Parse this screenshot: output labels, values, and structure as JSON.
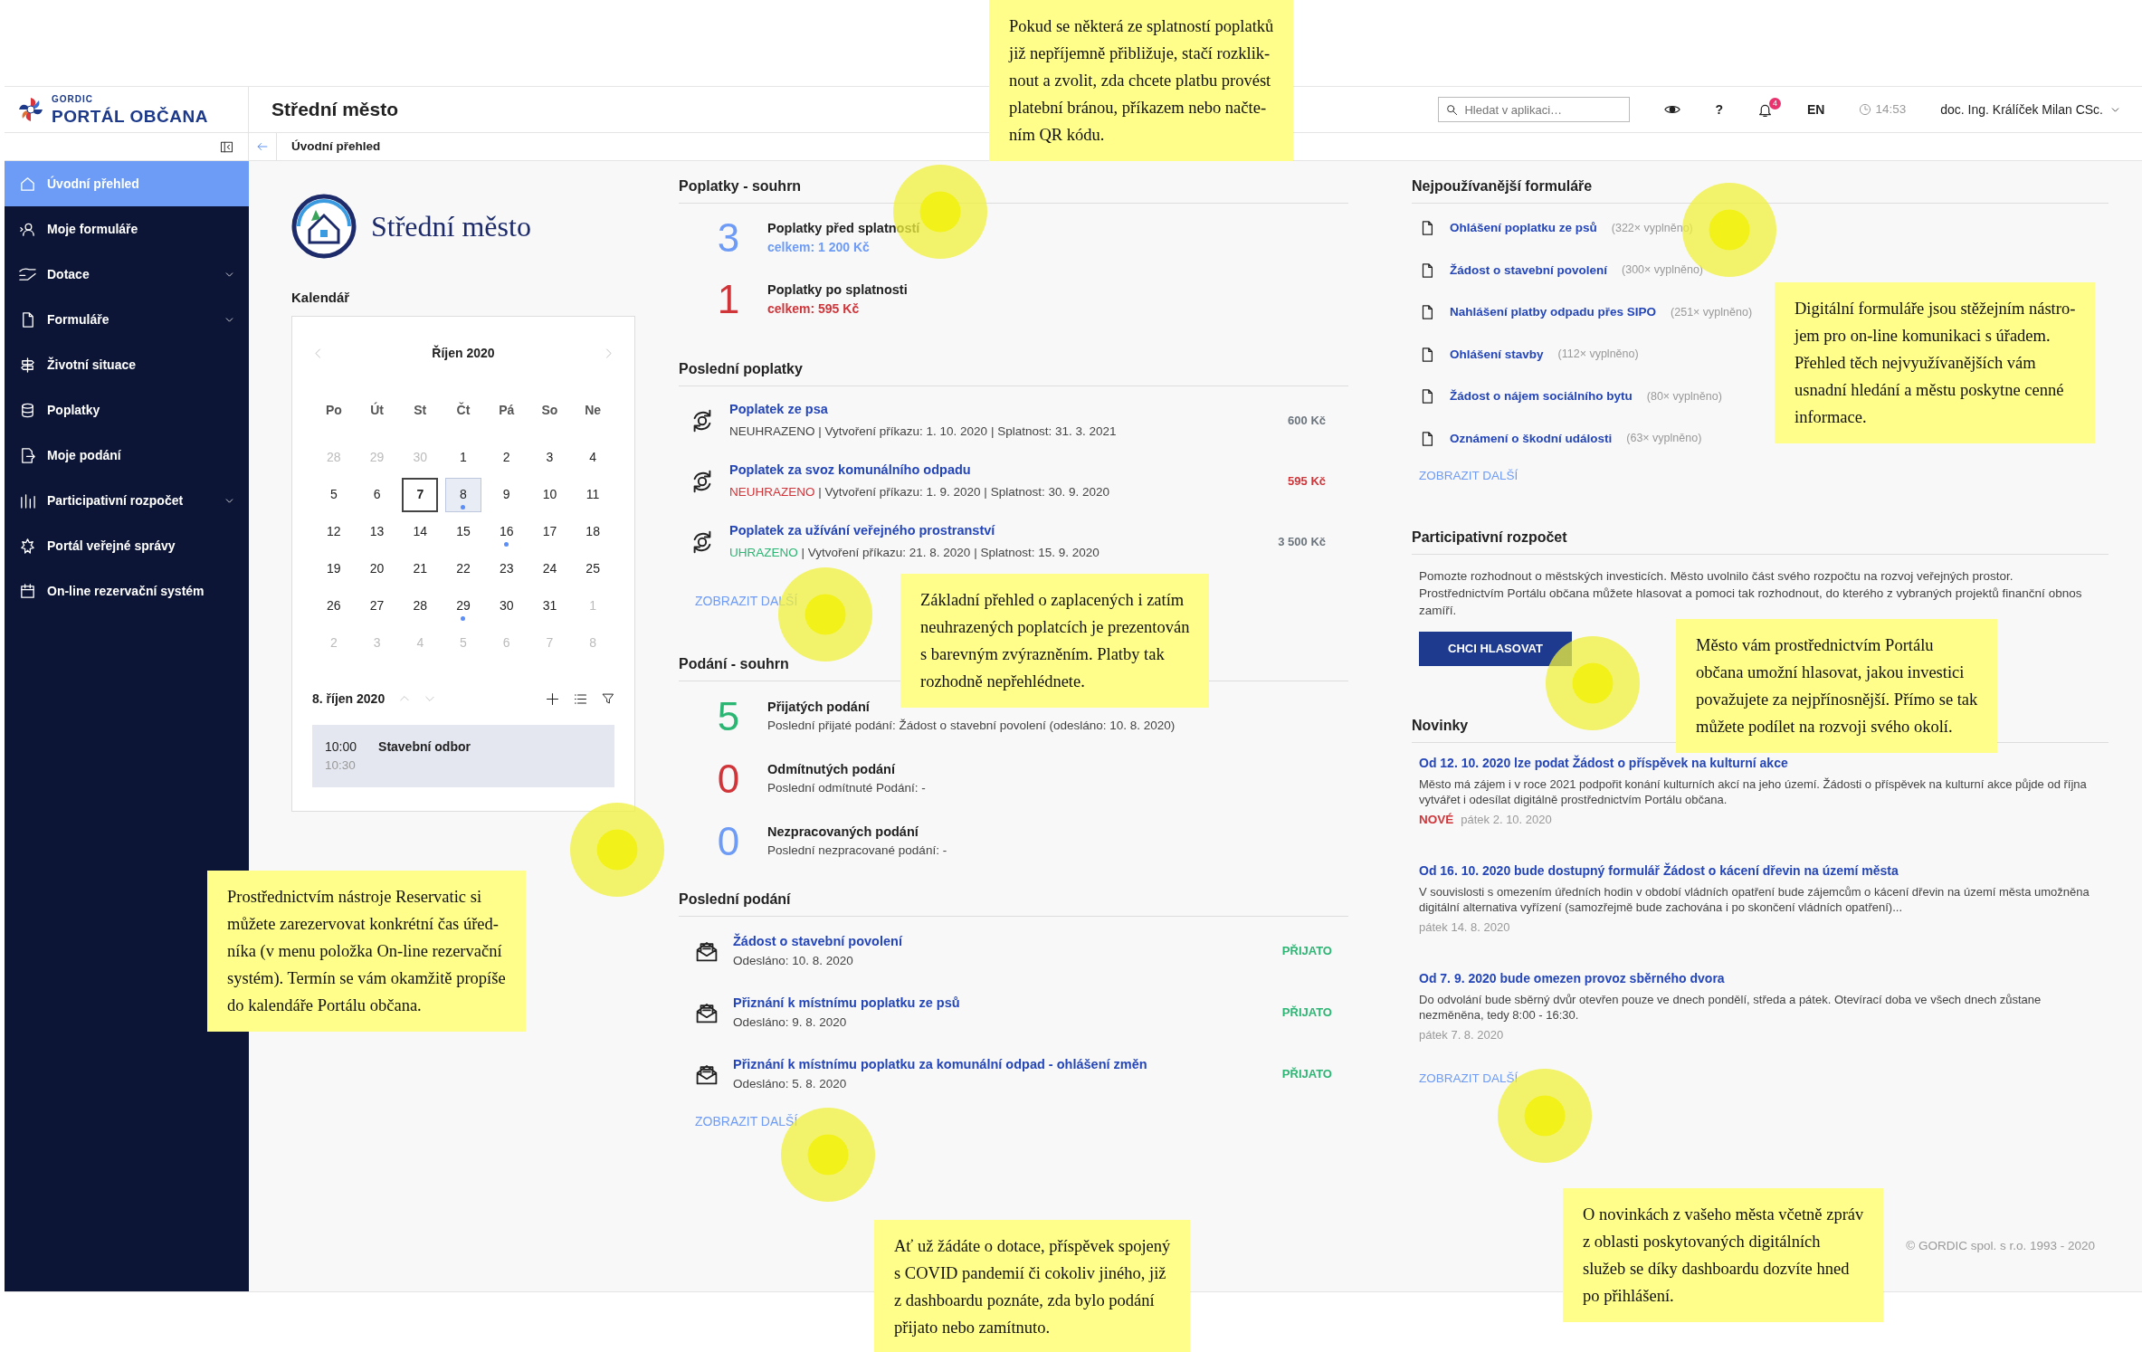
{
  "header": {
    "logo_small": "GORDIC",
    "logo_name": "PORTÁL OBČANA",
    "title": "Střední město",
    "search": {
      "placeholder": "Hledat v aplikaci…"
    },
    "help": "?",
    "notifications": "4",
    "language": "EN",
    "time": "14:53",
    "user": "doc. Ing. Králíček Milan CSc."
  },
  "breadcrumb": "Úvodní přehled",
  "sidebar": {
    "items": [
      {
        "label": "Úvodní přehled",
        "selected": true,
        "expandable": false
      },
      {
        "label": "Moje formuláře",
        "selected": false,
        "expandable": false
      },
      {
        "label": "Dotace",
        "selected": false,
        "expandable": true
      },
      {
        "label": "Formuláře",
        "selected": false,
        "expandable": true
      },
      {
        "label": "Životní situace",
        "selected": false,
        "expandable": false
      },
      {
        "label": "Poplatky",
        "selected": false,
        "expandable": false
      },
      {
        "label": "Moje podání",
        "selected": false,
        "expandable": false
      },
      {
        "label": "Participativní rozpočet",
        "selected": false,
        "expandable": true
      },
      {
        "label": "Portál veřejné správy",
        "selected": false,
        "expandable": false
      },
      {
        "label": "On-line rezervační systém",
        "selected": false,
        "expandable": false
      }
    ]
  },
  "city": {
    "name": "Střední město"
  },
  "calendar": {
    "title": "Kalendář",
    "month": "Říjen 2020",
    "weekdays": [
      "Po",
      "Út",
      "St",
      "Čt",
      "Pá",
      "So",
      "Ne"
    ],
    "weeks": [
      [
        {
          "d": "28",
          "other_month": true
        },
        {
          "d": "29",
          "other_month": true
        },
        {
          "d": "30",
          "other_month": true
        },
        {
          "d": "1"
        },
        {
          "d": "2"
        },
        {
          "d": "3"
        },
        {
          "d": "4"
        }
      ],
      [
        {
          "d": "5"
        },
        {
          "d": "6"
        },
        {
          "d": "7",
          "today": true
        },
        {
          "d": "8",
          "selected": true,
          "event": true
        },
        {
          "d": "9"
        },
        {
          "d": "10"
        },
        {
          "d": "11"
        }
      ],
      [
        {
          "d": "12"
        },
        {
          "d": "13"
        },
        {
          "d": "14"
        },
        {
          "d": "15"
        },
        {
          "d": "16",
          "event": true
        },
        {
          "d": "17"
        },
        {
          "d": "18"
        }
      ],
      [
        {
          "d": "19"
        },
        {
          "d": "20"
        },
        {
          "d": "21"
        },
        {
          "d": "22"
        },
        {
          "d": "23"
        },
        {
          "d": "24"
        },
        {
          "d": "25"
        }
      ],
      [
        {
          "d": "26"
        },
        {
          "d": "27"
        },
        {
          "d": "28"
        },
        {
          "d": "29",
          "event": true
        },
        {
          "d": "30"
        },
        {
          "d": "31"
        },
        {
          "d": "1",
          "other_month": true
        }
      ],
      [
        {
          "d": "2",
          "other_month": true
        },
        {
          "d": "3",
          "other_month": true
        },
        {
          "d": "4",
          "other_month": true
        },
        {
          "d": "5",
          "other_month": true
        },
        {
          "d": "6",
          "other_month": true
        },
        {
          "d": "7",
          "other_month": true
        },
        {
          "d": "8",
          "other_month": true
        }
      ]
    ],
    "day_label": "8. říjen 2020",
    "events": [
      {
        "start": "10:00",
        "end": "10:30",
        "name": "Stavební odbor"
      }
    ]
  },
  "fees_summary": {
    "title": "Poplatky - souhrn",
    "items": [
      {
        "count": "3",
        "kind": "info",
        "label": "Poplatky před splatností",
        "total": "celkem: 1 200 Kč"
      },
      {
        "count": "1",
        "kind": "danger",
        "label": "Poplatky po splatnosti",
        "total": "celkem: 595 Kč"
      }
    ]
  },
  "recent_fees": {
    "title": "Poslední poplatky",
    "items": [
      {
        "name": "Poplatek ze psa",
        "status": "NEUHRAZENO",
        "paid": false,
        "overdue": false,
        "details": "| Vytvoření příkazu: 1. 10. 2020 | Splatnost: 31. 3. 2021",
        "amount": "600 Kč"
      },
      {
        "name": "Poplatek za svoz komunálního odpadu",
        "status": "NEUHRAZENO",
        "paid": false,
        "overdue": true,
        "details": "| Vytvoření příkazu: 1. 9. 2020 | Splatnost: 30. 9. 2020",
        "amount": "595 Kč"
      },
      {
        "name": "Poplatek za užívání veřejného prostranství",
        "status": "UHRAZENO",
        "paid": true,
        "overdue": false,
        "details": "| Vytvoření příkazu: 21. 8. 2020 | Splatnost: 15. 9. 2020",
        "amount": "3 500 Kč"
      }
    ],
    "more": "ZOBRAZIT DALŠÍ"
  },
  "submissions_summary": {
    "title": "Podání - souhrn",
    "items": [
      {
        "count": "5",
        "kind": "success",
        "label": "Přijatých podání",
        "detail": "Poslední přijaté podání: Žádost o stavební povolení (odesláno: 10. 8. 2020)"
      },
      {
        "count": "0",
        "kind": "danger",
        "label": "Odmítnutých podání",
        "detail": "Poslední odmítnuté Podání: -"
      },
      {
        "count": "0",
        "kind": "info",
        "label": "Nezpracovaných podání",
        "detail": "Poslední nezpracované podání: -"
      }
    ]
  },
  "recent_submissions": {
    "title": "Poslední podání",
    "items": [
      {
        "name": "Žádost o stavební povolení",
        "sent": "Odesláno: 10. 8. 2020",
        "status": "PŘIJATO",
        "accepted": true
      },
      {
        "name": "Přiznání k místnímu poplatku ze psů",
        "sent": "Odesláno: 9. 8. 2020",
        "status": "PŘIJATO",
        "accepted": true
      },
      {
        "name": "Přiznání k místnímu poplatku za komunální odpad - ohlášení změn",
        "sent": "Odesláno: 5. 8. 2020",
        "status": "PŘIJATO",
        "accepted": true
      }
    ],
    "more": "ZOBRAZIT DALŠÍ"
  },
  "popular_forms": {
    "title": "Nejpoužívanější formuláře",
    "items": [
      {
        "name": "Ohlášení poplatku ze psů",
        "count": "(322× vyplněno)"
      },
      {
        "name": "Žádost o stavební povolení",
        "count": "(300× vyplněno)"
      },
      {
        "name": "Nahlášení platby odpadu přes SIPO",
        "count": "(251× vyplněno)"
      },
      {
        "name": "Ohlášení stavby",
        "count": "(112× vyplněno)"
      },
      {
        "name": "Žádost o nájem sociálního bytu",
        "count": "(80× vyplněno)"
      },
      {
        "name": "Oznámení o škodní události",
        "count": "(63× vyplněno)"
      }
    ],
    "more": "ZOBRAZIT DALŠÍ"
  },
  "participatory_budget": {
    "title": "Participativní rozpočet",
    "text": "Pomozte rozhodnout o městských investicích. Město uvolnilo část svého rozpočtu na rozvoj veřejných prostor. Prostřednictvím Portálu občana můžete hlasovat a pomoci tak rozhodnout, do kterého z vybraných projektů finanční obnos zamíří.",
    "button": "CHCI HLASOVAT"
  },
  "news": {
    "title": "Novinky",
    "items": [
      {
        "title": "Od 12. 10. 2020 lze podat Žádost o příspěvek na kulturní akce",
        "text": "Město má zájem i v roce 2021 podpořit konání kulturních akcí na jeho území. Žádosti o příspěvek na kulturní akce půjde od října vytvářet i odesílat digitálně prostřednictvím Portálu občana.",
        "badge": "NOVÉ",
        "date": "pátek 2. 10. 2020"
      },
      {
        "title": "Od 16. 10. 2020 bude dostupný formulář Žádost o kácení dřevin na území města",
        "text": "V souvislosti s omezením úředních hodin v období vládních opatření bude zájemcům o kácení dřevin na území města umožněna digitální alternativa vyřízení (samozřejmě bude zachována i po skončení vládních opatření)...",
        "date": "pátek 14. 8. 2020"
      },
      {
        "title": "Od 7. 9. 2020 bude omezen provoz sběrného dvora",
        "text": "Do odvolání bude sběrný dvůr otevřen pouze ve dnech pondělí, středa a pátek. Otevírací doba ve všech dnech zůstane nezměněna, tedy 8:00 - 16:30.",
        "date": "pátek 7. 8. 2020"
      }
    ],
    "more": "ZOBRAZIT DALŠÍ"
  },
  "footer": "© GORDIC spol. s r.o. 1993 - 2020",
  "callouts": [
    {
      "lines": [
        "Pokud se některá ze splatností poplatků",
        "již nepříjemně přibližuje, stačí rozklik-",
        "nout a zvolit, zda chcete platbu provést",
        "platební bránou, příkazem nebo načte-",
        "ním QR kódu."
      ]
    },
    {
      "lines": [
        "Základní přehled o zaplacených i zatím",
        "neuhrazených poplatcích je prezentován",
        "s barevným zvýrazněním. Platby tak",
        "rozhodně nepřehlédnete."
      ]
    },
    {
      "lines": [
        "Prostřednictvím nástroje Reservatic si",
        "můžete zarezervovat konkrétní čas úřed-",
        "níka (v menu položka On-line rezervační",
        "systém). Termín se vám okamžitě propíše",
        "do kalendáře Portálu občana."
      ]
    },
    {
      "lines": [
        "Digitální formuláře jsou stěžejním nástro-",
        "jem pro on-line komunikaci s úřadem.",
        "Přehled těch nejvyužívanějších vám",
        "usnadní hledání a městu poskytne cenné",
        "informace."
      ]
    },
    {
      "lines": [
        "Město vám prostřednictvím Portálu",
        "občana umožní hlasovat, jakou investici",
        "považujete za nejpřínosnější. Přímo se tak",
        "můžete podílet na rozvoji svého okolí."
      ]
    },
    {
      "lines": [
        "Ať už žádáte o dotace, příspěvek spojený",
        "s COVID pandemií či cokoliv jiného, již",
        "z dashboardu poznáte, zda bylo podání",
        "přijato nebo zamítnuto."
      ]
    },
    {
      "lines": [
        "O novinkách z vašeho města včetně zpráv",
        "z oblasti poskytovaných digitálních",
        "služeb se díky dashboardu dozvíte hned",
        "po přihlášení."
      ]
    }
  ]
}
